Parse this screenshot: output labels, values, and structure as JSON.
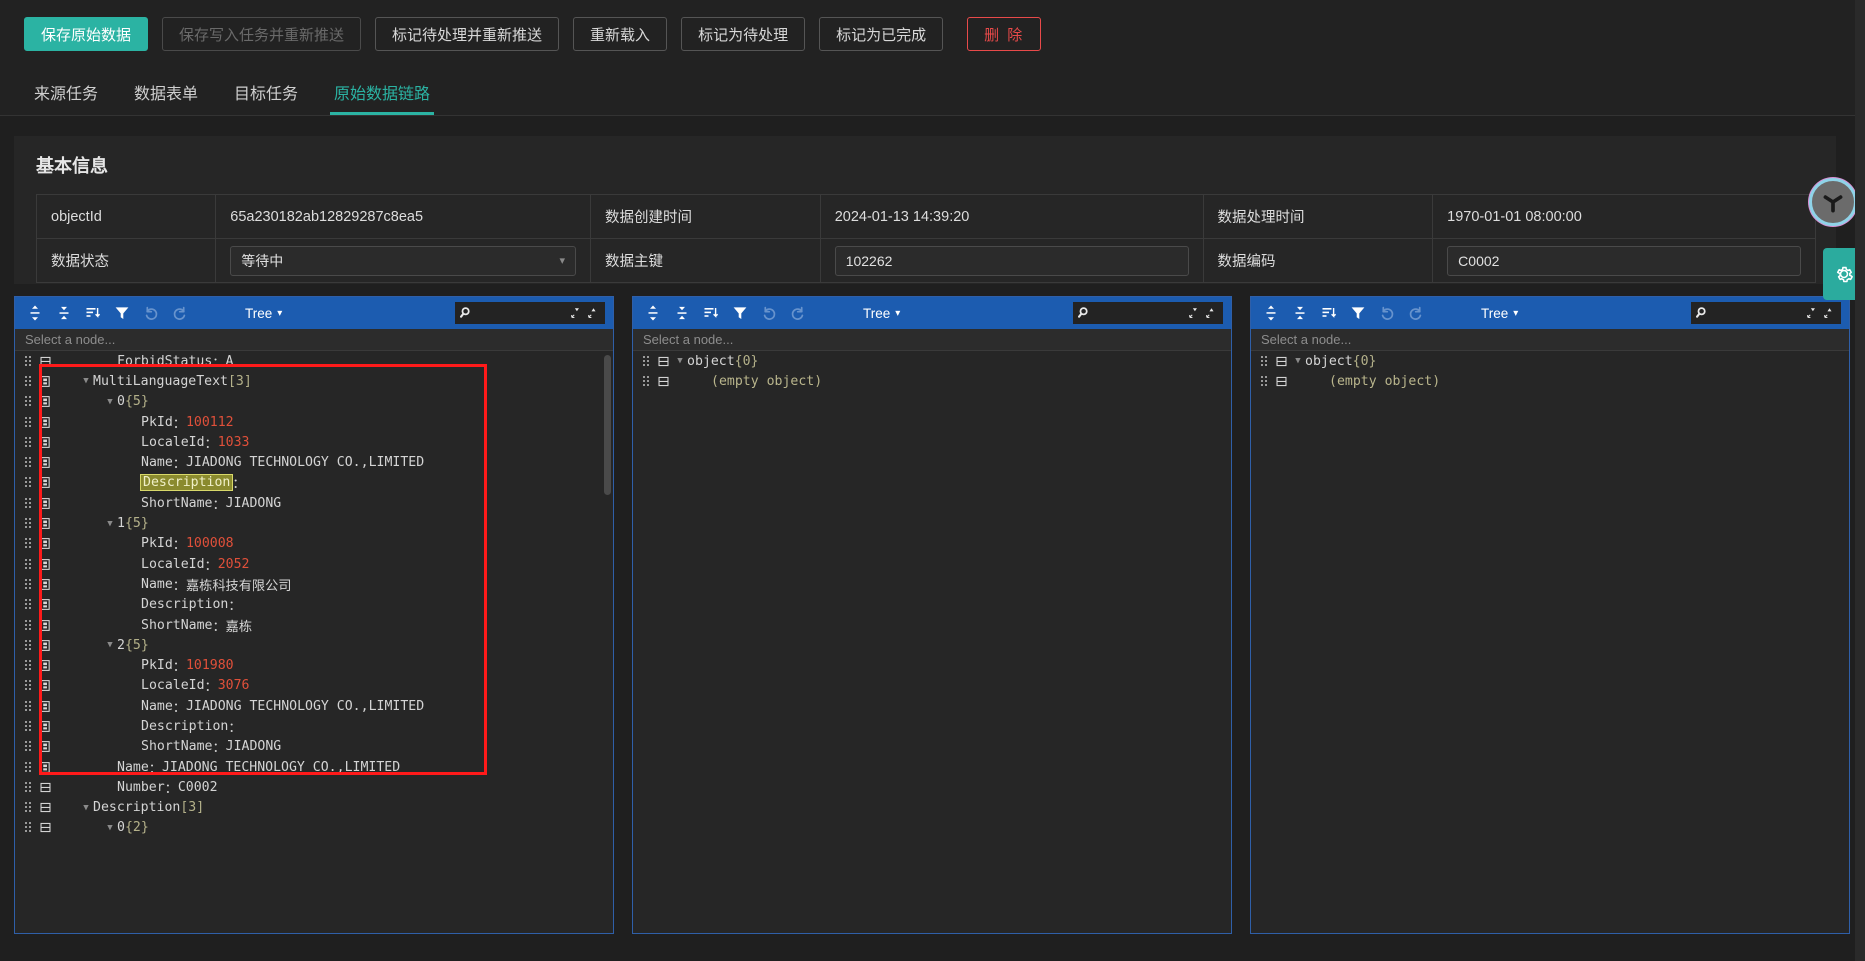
{
  "toolbar": {
    "buttons": [
      {
        "label": "保存原始数据",
        "style": "primary"
      },
      {
        "label": "保存写入任务并重新推送",
        "style": "disabled"
      },
      {
        "label": "标记待处理并重新推送",
        "style": "normal"
      },
      {
        "label": "重新载入",
        "style": "normal"
      },
      {
        "label": "标记为待处理",
        "style": "normal"
      },
      {
        "label": "标记为已完成",
        "style": "normal"
      },
      {
        "label": "删 除",
        "style": "danger"
      }
    ]
  },
  "tabs": [
    {
      "label": "来源任务",
      "active": false
    },
    {
      "label": "数据表单",
      "active": false
    },
    {
      "label": "目标任务",
      "active": false
    },
    {
      "label": "原始数据链路",
      "active": true
    }
  ],
  "card": {
    "title": "基本信息",
    "row1": {
      "label1": "objectId",
      "value1": "65a230182ab12829287c8ea5",
      "label2": "数据创建时间",
      "value2": "2024-01-13 14:39:20",
      "label3": "数据处理时间",
      "value3": "1970-01-01 08:00:00"
    },
    "row2": {
      "label1": "数据状态",
      "value1": "等待中",
      "label2": "数据主键",
      "value2": "102262",
      "label3": "数据编码",
      "value3": "C0002"
    }
  },
  "panel_common": {
    "mode_label": "Tree",
    "select_node_placeholder": "Select a node...",
    "search_placeholder": ""
  },
  "panels": [
    {
      "id": "panel-left",
      "rows": [
        {
          "indent": 2,
          "arrow": "none",
          "key": "ForbidStatus",
          "sep": "：",
          "value": "A",
          "vtype": "str",
          "icon": "plain"
        },
        {
          "indent": 1,
          "arrow": "down",
          "key": "MultiLanguageText",
          "sep": "",
          "value": "[3]",
          "vtype": "meta",
          "icon": "marked"
        },
        {
          "indent": 2,
          "arrow": "down",
          "key": "0",
          "sep": "",
          "value": "{5}",
          "vtype": "meta",
          "icon": "marked"
        },
        {
          "indent": 3,
          "arrow": "none",
          "key": "PkId",
          "sep": "：",
          "value": "100112",
          "vtype": "num",
          "icon": "marked"
        },
        {
          "indent": 3,
          "arrow": "none",
          "key": "LocaleId",
          "sep": "：",
          "value": "1033",
          "vtype": "num",
          "icon": "marked"
        },
        {
          "indent": 3,
          "arrow": "none",
          "key": "Name",
          "sep": "：",
          "value": "JIADONG TECHNOLOGY CO.,LIMITED",
          "vtype": "str",
          "icon": "marked"
        },
        {
          "indent": 3,
          "arrow": "none",
          "key": "Description",
          "sep": "：",
          "value": "",
          "vtype": "str",
          "icon": "marked",
          "highlight": true
        },
        {
          "indent": 3,
          "arrow": "none",
          "key": "ShortName",
          "sep": "：",
          "value": "JIADONG",
          "vtype": "str",
          "icon": "marked"
        },
        {
          "indent": 2,
          "arrow": "down",
          "key": "1",
          "sep": "",
          "value": "{5}",
          "vtype": "meta",
          "icon": "marked"
        },
        {
          "indent": 3,
          "arrow": "none",
          "key": "PkId",
          "sep": "：",
          "value": "100008",
          "vtype": "num",
          "icon": "marked"
        },
        {
          "indent": 3,
          "arrow": "none",
          "key": "LocaleId",
          "sep": "：",
          "value": "2052",
          "vtype": "num",
          "icon": "marked"
        },
        {
          "indent": 3,
          "arrow": "none",
          "key": "Name",
          "sep": "：",
          "value": "嘉栋科技有限公司",
          "vtype": "str",
          "icon": "marked"
        },
        {
          "indent": 3,
          "arrow": "none",
          "key": "Description",
          "sep": "：",
          "value": "",
          "vtype": "str",
          "icon": "marked"
        },
        {
          "indent": 3,
          "arrow": "none",
          "key": "ShortName",
          "sep": "：",
          "value": "嘉栋",
          "vtype": "str",
          "icon": "marked"
        },
        {
          "indent": 2,
          "arrow": "down",
          "key": "2",
          "sep": "",
          "value": "{5}",
          "vtype": "meta",
          "icon": "marked"
        },
        {
          "indent": 3,
          "arrow": "none",
          "key": "PkId",
          "sep": "：",
          "value": "101980",
          "vtype": "num",
          "icon": "marked"
        },
        {
          "indent": 3,
          "arrow": "none",
          "key": "LocaleId",
          "sep": "：",
          "value": "3076",
          "vtype": "num",
          "icon": "marked"
        },
        {
          "indent": 3,
          "arrow": "none",
          "key": "Name",
          "sep": "：",
          "value": "JIADONG TECHNOLOGY CO.,LIMITED",
          "vtype": "str",
          "icon": "marked"
        },
        {
          "indent": 3,
          "arrow": "none",
          "key": "Description",
          "sep": "：",
          "value": "",
          "vtype": "str",
          "icon": "marked"
        },
        {
          "indent": 3,
          "arrow": "none",
          "key": "ShortName",
          "sep": "：",
          "value": "JIADONG",
          "vtype": "str",
          "icon": "marked"
        },
        {
          "indent": 2,
          "arrow": "none",
          "key": "Name",
          "sep": "：",
          "value": "JIADONG TECHNOLOGY CO.,LIMITED",
          "vtype": "str",
          "icon": "marked"
        },
        {
          "indent": 2,
          "arrow": "none",
          "key": "Number",
          "sep": "：",
          "value": "C0002",
          "vtype": "str",
          "icon": "plain"
        },
        {
          "indent": 1,
          "arrow": "down",
          "key": "Description",
          "sep": "",
          "value": "[3]",
          "vtype": "meta",
          "icon": "plain"
        },
        {
          "indent": 2,
          "arrow": "down",
          "key": "0",
          "sep": "",
          "value": "{2}",
          "vtype": "meta",
          "icon": "plain"
        }
      ]
    },
    {
      "id": "panel-middle",
      "rows": [
        {
          "indent": 0,
          "arrow": "down",
          "key": "object",
          "sep": "",
          "value": "{0}",
          "vtype": "meta",
          "icon": "plain"
        },
        {
          "indent": 1,
          "arrow": "none",
          "key": "",
          "sep": "",
          "value": "(empty object)",
          "vtype": "empty",
          "icon": "plain"
        }
      ]
    },
    {
      "id": "panel-right",
      "rows": [
        {
          "indent": 0,
          "arrow": "down",
          "key": "object",
          "sep": "",
          "value": "{0}",
          "vtype": "meta",
          "icon": "plain"
        },
        {
          "indent": 1,
          "arrow": "none",
          "key": "",
          "sep": "",
          "value": "(empty object)",
          "vtype": "empty",
          "icon": "plain"
        }
      ]
    }
  ],
  "icons": {
    "expand_all": "expand-all-icon",
    "collapse_all": "collapse-all-icon",
    "sort": "sort-icon",
    "filter": "filter-icon",
    "undo": "undo-icon",
    "redo": "redo-icon",
    "search": "search-icon",
    "search_next": "search-next-icon",
    "search_prev": "search-prev-icon",
    "gear": "gear-icon",
    "logo": "app-logo-icon"
  },
  "colors": {
    "accent": "#2bb3a3",
    "danger": "#e84a4a",
    "panel_header": "#1c5cb0",
    "number": "#e0503a",
    "highlight": "#8a8a2e",
    "annotation": "#ff1a1a"
  }
}
